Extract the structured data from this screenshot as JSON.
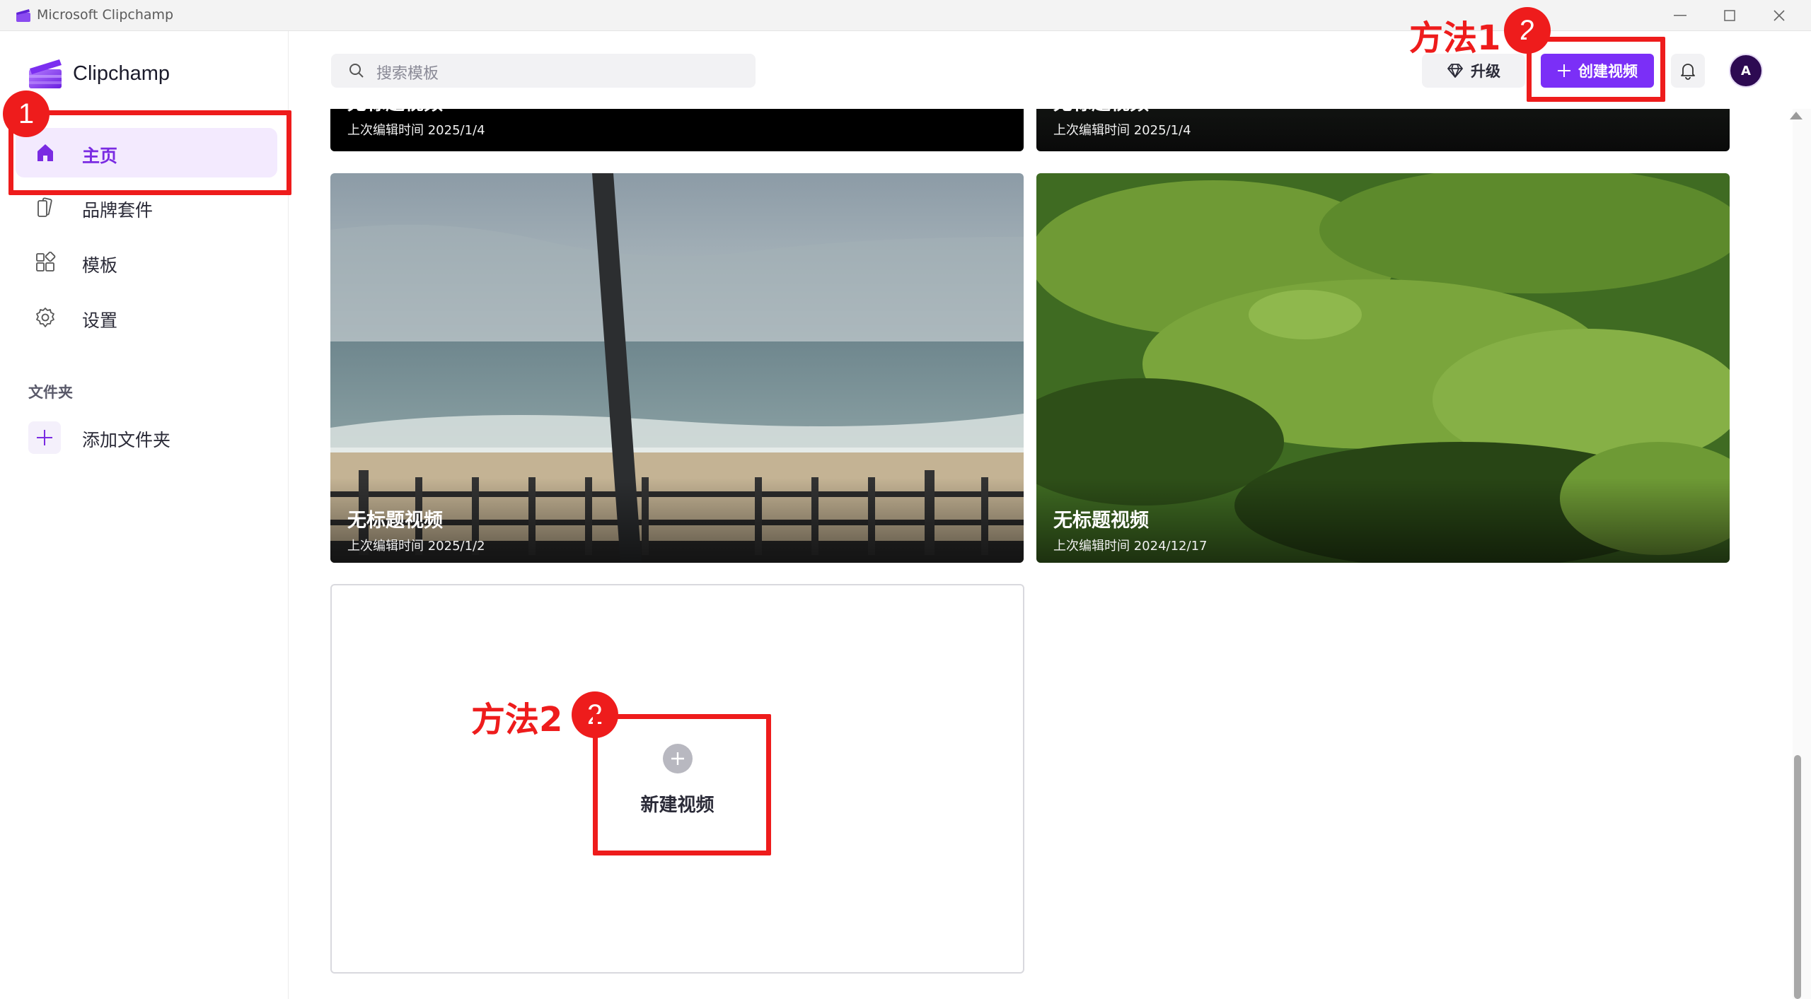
{
  "window": {
    "title": "Microsoft Clipchamp",
    "minimize_icon": "minimize-icon",
    "maximize_icon": "maximize-icon",
    "close_icon": "close-icon"
  },
  "sidebar": {
    "brand": "Clipchamp",
    "items": [
      {
        "label": "主页",
        "icon": "home-icon",
        "active": true
      },
      {
        "label": "品牌套件",
        "icon": "brand-kit-icon",
        "active": false
      },
      {
        "label": "模板",
        "icon": "templates-icon",
        "active": false
      },
      {
        "label": "设置",
        "icon": "settings-gear-icon",
        "active": false
      }
    ],
    "folders_section": "文件夹",
    "add_folder": "添加文件夹"
  },
  "header": {
    "search_placeholder": "搜索模板",
    "upgrade_label": "升级",
    "create_label": "创建视频",
    "avatar_initial": "A"
  },
  "videos": [
    {
      "title": "无标题视频",
      "date": "上次编辑时间 2025/1/4"
    },
    {
      "title": "无标题视频",
      "date": "上次编辑时间 2025/1/4"
    },
    {
      "title": "无标题视频",
      "date": "上次编辑时间 2025/1/2"
    },
    {
      "title": "无标题视频",
      "date": "上次编辑时间 2024/12/17"
    }
  ],
  "new_video_label": "新建视频",
  "annotations": {
    "step1": "1",
    "method1": "方法1",
    "method1_step": "2",
    "method2": "方法2",
    "method2_step": "2"
  },
  "colors": {
    "accent": "#7b2ff7",
    "annotation": "#ee1c1c",
    "active_nav_bg": "#f3eafe"
  }
}
